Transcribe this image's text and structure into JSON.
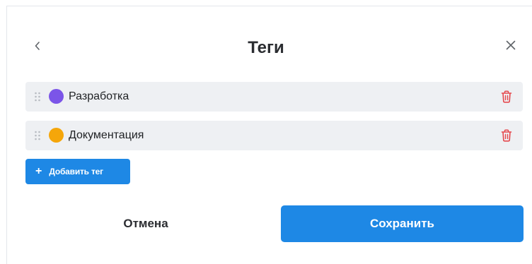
{
  "dialog": {
    "title": "Теги",
    "back_icon": "chevron-left-icon",
    "close_icon": "close-icon"
  },
  "tags": [
    {
      "label": "Разработка",
      "color": "#7b55e8"
    },
    {
      "label": "Документация",
      "color": "#f5a60a"
    }
  ],
  "actions": {
    "add_tag_plus": "+",
    "add_tag_label": "Добавить тег",
    "cancel_label": "Отмена",
    "save_label": "Сохранить"
  },
  "colors": {
    "accent": "#1e88e5",
    "delete": "#e5484d",
    "row_bg": "#eef0f3"
  }
}
